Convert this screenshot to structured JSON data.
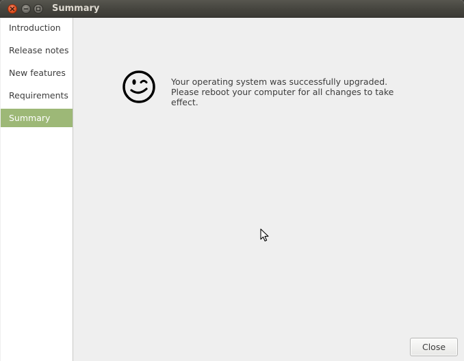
{
  "window": {
    "title": "Summary",
    "controls": [
      "close-icon",
      "minimize-icon",
      "maximize-icon"
    ]
  },
  "sidebar": {
    "items": [
      {
        "label": "Introduction",
        "active": false
      },
      {
        "label": "Release notes",
        "active": false
      },
      {
        "label": "New features",
        "active": false
      },
      {
        "label": "Requirements",
        "active": false
      },
      {
        "label": "Summary",
        "active": true
      }
    ]
  },
  "main": {
    "icon": "smiley-wink-icon",
    "message": "Your operating system was successfully upgraded. Please reboot your computer for all changes to take effect."
  },
  "footer": {
    "close_label": "Close"
  },
  "colors": {
    "titlebar": "#45443e",
    "active_item": "#9db877",
    "content_bg": "#efefef",
    "close_button": "#e2501f"
  }
}
